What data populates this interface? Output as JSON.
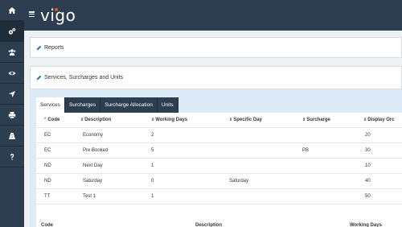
{
  "app": {
    "logo": "vigo"
  },
  "sidebar": {
    "items": [
      {
        "icon": "home-icon"
      },
      {
        "icon": "cogs-icon"
      },
      {
        "icon": "users-icon"
      },
      {
        "icon": "eye-icon"
      },
      {
        "icon": "location-arrow-icon"
      },
      {
        "icon": "print-icon"
      },
      {
        "icon": "road-icon"
      },
      {
        "icon": "question-icon"
      }
    ]
  },
  "panels": {
    "reports": "Reports",
    "services": "Services, Surcharges and Units"
  },
  "tabs": [
    "Services",
    "Surcharges",
    "Surcharge Allocation",
    "Units"
  ],
  "table": {
    "headers": [
      "Code",
      "Description",
      "Working Days",
      "Specific Day",
      "Surcharge",
      "Display Orc"
    ],
    "rows": [
      [
        "EC",
        "Economy",
        "2",
        "",
        "",
        "20"
      ],
      [
        "EC",
        "Pre Booked",
        "5",
        "",
        "PB",
        "30"
      ],
      [
        "ND",
        "Next Day",
        "1",
        "",
        "",
        "10"
      ],
      [
        "ND",
        "Saturday",
        "0",
        "Saturday",
        "",
        "40"
      ],
      [
        "TT",
        "Test 1",
        "1",
        "",
        "",
        "50"
      ]
    ],
    "footer": [
      "Code",
      "Description",
      "Working Days"
    ]
  },
  "colors": {
    "sidebar": "#2c3e50",
    "accent": "#2a6ebb",
    "required": "#e8542f"
  }
}
